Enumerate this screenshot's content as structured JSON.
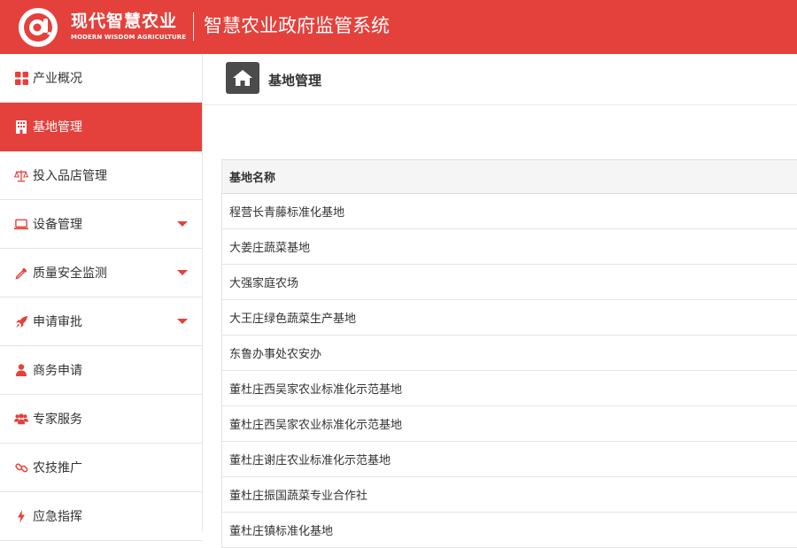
{
  "header": {
    "logo_cn": "现代智慧农业",
    "logo_en": "MODERN WISDOM AGRICULTURE",
    "system_title": "智慧农业政府监管系统",
    "brand_color": "#e5413c"
  },
  "sidebar": {
    "items": [
      {
        "label": "产业概况",
        "icon": "grid-icon",
        "active": false,
        "has_submenu": false
      },
      {
        "label": "基地管理",
        "icon": "building-icon",
        "active": true,
        "has_submenu": false
      },
      {
        "label": "投入品店管理",
        "icon": "scale-icon",
        "active": false,
        "has_submenu": false
      },
      {
        "label": "设备管理",
        "icon": "laptop-icon",
        "active": false,
        "has_submenu": true
      },
      {
        "label": "质量安全监测",
        "icon": "eyedropper-icon",
        "active": false,
        "has_submenu": true
      },
      {
        "label": "申请审批",
        "icon": "rocket-icon",
        "active": false,
        "has_submenu": true
      },
      {
        "label": "商务申请",
        "icon": "user-icon",
        "active": false,
        "has_submenu": false
      },
      {
        "label": "专家服务",
        "icon": "users-icon",
        "active": false,
        "has_submenu": false
      },
      {
        "label": "农技推广",
        "icon": "link-icon",
        "active": false,
        "has_submenu": false
      },
      {
        "label": "应急指挥",
        "icon": "bolt-icon",
        "active": false,
        "has_submenu": false
      }
    ]
  },
  "breadcrumb": {
    "title": "基地管理",
    "icon": "home-icon"
  },
  "table": {
    "header": "基地名称",
    "rows": [
      "程营长青藤标准化基地",
      "大姜庄蔬菜基地",
      "大强家庭农场",
      "大王庄绿色蔬菜生产基地",
      "东鲁办事处农安办",
      "董杜庄西吴家农业标准化示范基地",
      "董杜庄西吴家农业标准化示范基地",
      "董杜庄谢庄农业标准化示范基地",
      "董杜庄振国蔬菜专业合作社",
      "董杜庄镇标准化基地"
    ]
  }
}
